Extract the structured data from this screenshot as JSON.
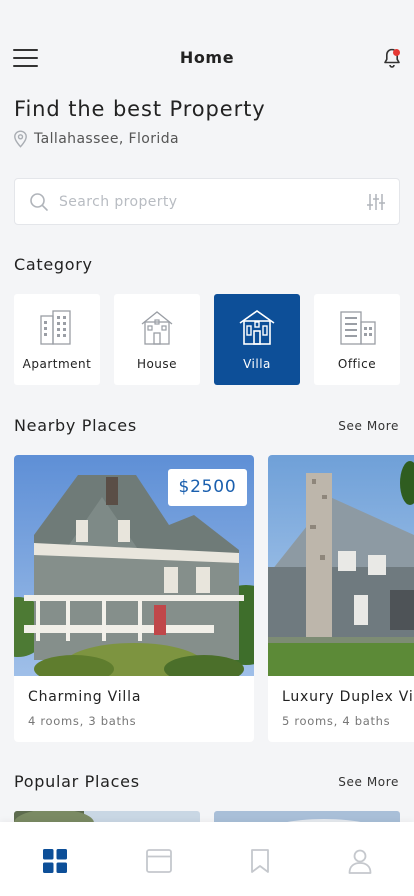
{
  "header": {
    "title": "Home",
    "menu_icon": "hamburger-menu-icon",
    "notification_icon": "bell-icon",
    "notification_dot_color": "#e53935"
  },
  "headline": "Find the best Property",
  "location": {
    "icon": "location-pin-icon",
    "text": "Tallahassee, Florida"
  },
  "search": {
    "placeholder": "Search property",
    "value": "",
    "icon": "search-icon",
    "filter_icon": "filter-sliders-icon"
  },
  "category": {
    "title": "Category",
    "selected": "Villa",
    "accent_color": "#0d4f98",
    "items": [
      {
        "label": "Apartment",
        "icon": "apartment-building-icon",
        "active": false
      },
      {
        "label": "House",
        "icon": "house-icon",
        "active": false
      },
      {
        "label": "Villa",
        "icon": "villa-icon",
        "active": true
      },
      {
        "label": "Office",
        "icon": "office-building-icon",
        "active": false
      }
    ]
  },
  "nearby": {
    "title": "Nearby Places",
    "see_more": "See More",
    "cards": [
      {
        "name": "Charming Villa",
        "details": "4 rooms, 3 baths",
        "price": "$2500",
        "image": "victorian-villa-photo"
      },
      {
        "name": "Luxury Duplex Vil",
        "details": "5 rooms, 4 baths",
        "price": "",
        "image": "stone-chimney-house-photo"
      }
    ]
  },
  "popular": {
    "title": "Popular Places",
    "see_more": "See More"
  },
  "bottom_nav": {
    "active_color": "#0d4f98",
    "inactive_color": "#c5c8cd",
    "items": [
      {
        "icon": "dashboard-grid-icon",
        "active": true
      },
      {
        "icon": "browser-window-icon",
        "active": false
      },
      {
        "icon": "bookmark-icon",
        "active": false
      },
      {
        "icon": "user-profile-icon",
        "active": false
      }
    ]
  }
}
